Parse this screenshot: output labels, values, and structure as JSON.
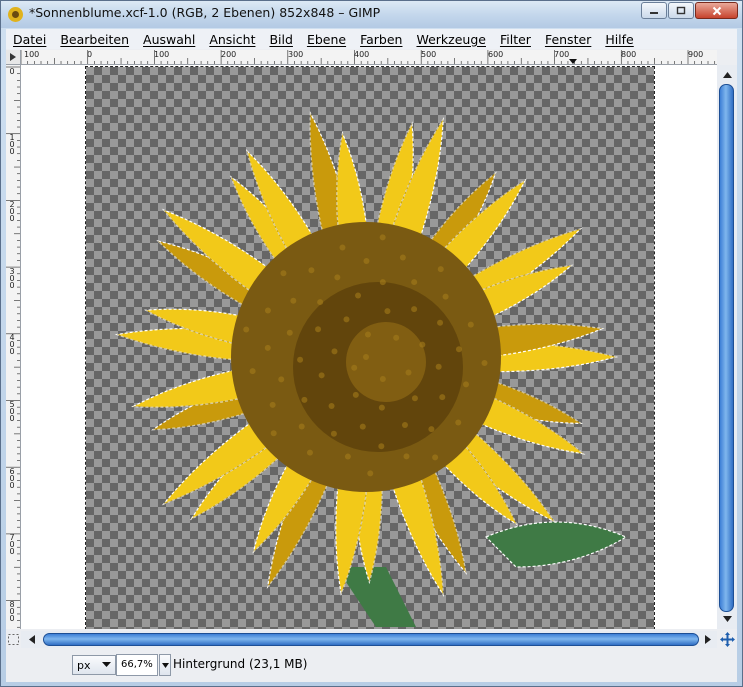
{
  "window": {
    "title": "*Sonnenblume.xcf-1.0 (RGB, 2 Ebenen) 852x848 – GIMP"
  },
  "menubar": {
    "items": [
      {
        "label": "Datei"
      },
      {
        "label": "Bearbeiten"
      },
      {
        "label": "Auswahl"
      },
      {
        "label": "Ansicht"
      },
      {
        "label": "Bild"
      },
      {
        "label": "Ebene"
      },
      {
        "label": "Farben"
      },
      {
        "label": "Werkzeuge"
      },
      {
        "label": "Filter"
      },
      {
        "label": "Fenster"
      },
      {
        "label": "Hilfe"
      }
    ]
  },
  "rulers": {
    "horizontal_labels": [
      "100",
      "0",
      "100",
      "200",
      "300",
      "400",
      "500",
      "600",
      "700",
      "800",
      "900"
    ],
    "vertical_labels": [
      "0",
      "100",
      "200",
      "300",
      "400",
      "500",
      "600",
      "700",
      "800"
    ]
  },
  "statusbar": {
    "unit": "px",
    "zoom": "66,7%",
    "layer_info": "Hintergrund (23,1 MB)"
  },
  "colors": {
    "petal": "#f2c919",
    "petal_shadow": "#c99a0c",
    "center": "#7a5a12",
    "center_dark": "#4f3508",
    "leaf": "#3f7a45",
    "scroll_thumb": "#3d7fd6"
  }
}
